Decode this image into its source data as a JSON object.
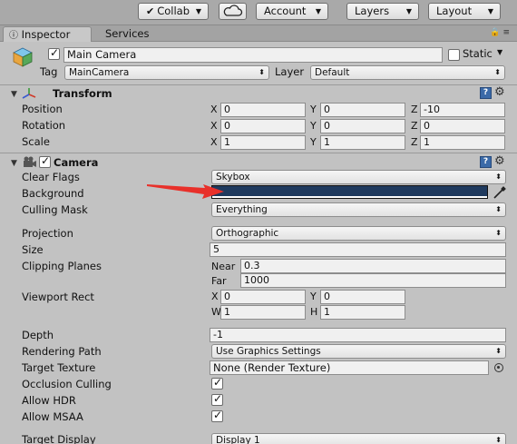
{
  "toolbar": {
    "collab_label": "Collab",
    "account_label": "Account",
    "layers_label": "Layers",
    "layout_label": "Layout"
  },
  "tabs": {
    "inspector": "Inspector",
    "services": "Services"
  },
  "gameobject": {
    "name": "Main Camera",
    "static_label": "Static",
    "tag_label": "Tag",
    "tag_value": "MainCamera",
    "layer_label": "Layer",
    "layer_value": "Default"
  },
  "transform": {
    "title": "Transform",
    "rows": [
      {
        "label": "Position",
        "x": "0",
        "y": "0",
        "z": "-10"
      },
      {
        "label": "Rotation",
        "x": "0",
        "y": "0",
        "z": "0"
      },
      {
        "label": "Scale",
        "x": "1",
        "y": "1",
        "z": "1"
      }
    ],
    "axis_x": "X",
    "axis_y": "Y",
    "axis_z": "Z"
  },
  "camera": {
    "title": "Camera",
    "clear_flags_label": "Clear Flags",
    "clear_flags_value": "Skybox",
    "background_label": "Background",
    "background_color": "#1f3a5e",
    "culling_mask_label": "Culling Mask",
    "culling_mask_value": "Everything",
    "projection_label": "Projection",
    "projection_value": "Orthographic",
    "size_label": "Size",
    "size_value": "5",
    "clipping_label": "Clipping Planes",
    "near_label": "Near",
    "near_value": "0.3",
    "far_label": "Far",
    "far_value": "1000",
    "viewport_label": "Viewport Rect",
    "vp_x_label": "X",
    "vp_x": "0",
    "vp_y_label": "Y",
    "vp_y": "0",
    "vp_w_label": "W",
    "vp_w": "1",
    "vp_h_label": "H",
    "vp_h": "1",
    "depth_label": "Depth",
    "depth_value": "-1",
    "rendering_path_label": "Rendering Path",
    "rendering_path_value": "Use Graphics Settings",
    "target_texture_label": "Target Texture",
    "target_texture_value": "None (Render Texture)",
    "occlusion_label": "Occlusion Culling",
    "hdr_label": "Allow HDR",
    "msaa_label": "Allow MSAA",
    "target_display_label": "Target Display",
    "target_display_value": "Display 1"
  },
  "annotation": {
    "arrow_color": "#e8302a"
  }
}
